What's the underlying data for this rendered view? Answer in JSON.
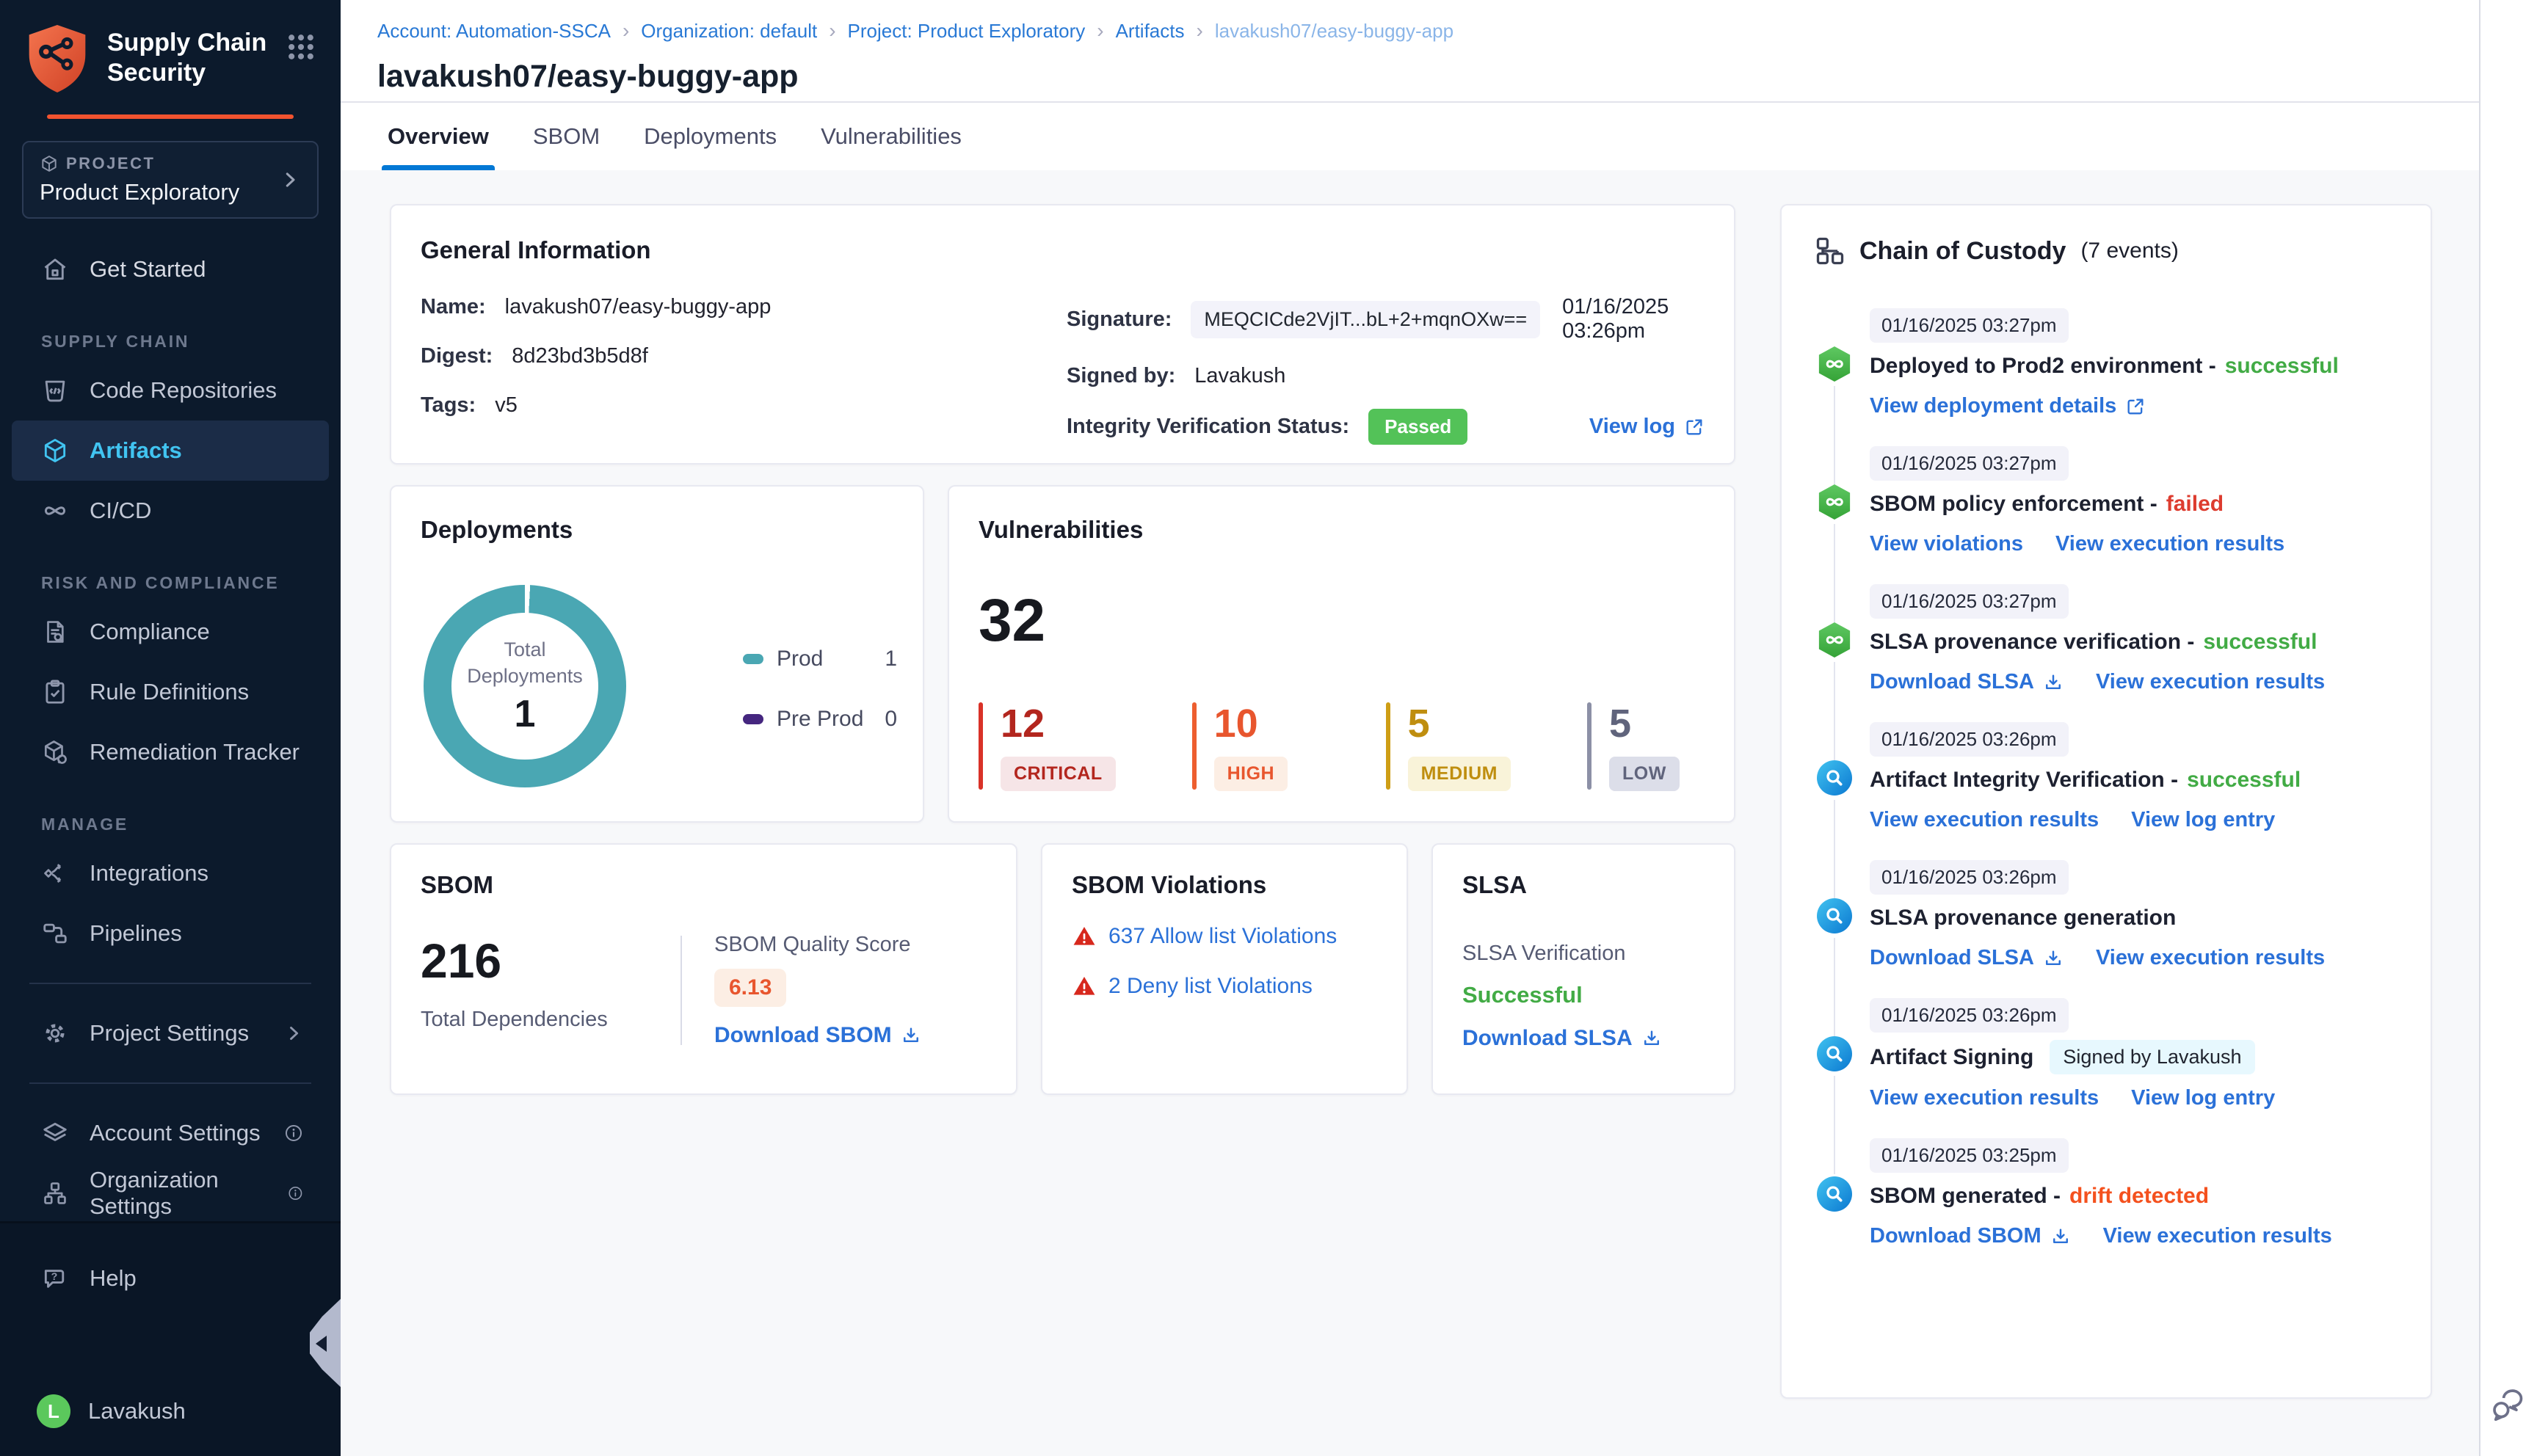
{
  "app": {
    "name_line1": "Supply Chain",
    "name_line2": "Security"
  },
  "sidebar": {
    "project_label": "PROJECT",
    "project_name": "Product Exploratory",
    "get_started": "Get Started",
    "sections": [
      {
        "title": "SUPPLY CHAIN",
        "items": [
          {
            "label": "Code Repositories"
          },
          {
            "label": "Artifacts",
            "active": true
          },
          {
            "label": "CI/CD"
          }
        ]
      },
      {
        "title": "RISK AND COMPLIANCE",
        "items": [
          {
            "label": "Compliance"
          },
          {
            "label": "Rule Definitions"
          },
          {
            "label": "Remediation Tracker"
          }
        ]
      },
      {
        "title": "MANAGE",
        "items": [
          {
            "label": "Integrations"
          },
          {
            "label": "Pipelines"
          }
        ]
      }
    ],
    "project_settings": "Project Settings",
    "account_settings": "Account Settings",
    "organization_settings": "Organization Settings",
    "help": "Help",
    "user": {
      "name": "Lavakush",
      "initial": "L"
    }
  },
  "breadcrumb": [
    "Account: Automation-SSCA",
    "Organization: default",
    "Project: Product Exploratory",
    "Artifacts",
    "lavakush07/easy-buggy-app"
  ],
  "page": {
    "title": "lavakush07/easy-buggy-app"
  },
  "tabs": [
    {
      "label": "Overview",
      "active": true
    },
    {
      "label": "SBOM"
    },
    {
      "label": "Deployments"
    },
    {
      "label": "Vulnerabilities"
    }
  ],
  "general_info": {
    "title": "General Information",
    "name_label": "Name:",
    "name_value": "lavakush07/easy-buggy-app",
    "digest_label": "Digest:",
    "digest_value": "8d23bd3b5d8f",
    "tags_label": "Tags:",
    "tags_value": "v5",
    "signature_label": "Signature:",
    "signature_value": "MEQCICde2VjIT...bL+2+mqnOXw==",
    "signature_time": "01/16/2025 03:26pm",
    "signed_by_label": "Signed by:",
    "signed_by_value": "Lavakush",
    "integrity_label": "Integrity Verification Status:",
    "integrity_status": "Passed",
    "view_log": "View log"
  },
  "deployments_card": {
    "title": "Deployments",
    "chart_data": {
      "type": "pie",
      "center_label": "Total Deployments",
      "total": 1,
      "series": [
        {
          "name": "Prod",
          "value": 1,
          "color": "#4AA7B3"
        },
        {
          "name": "Pre Prod",
          "value": 0,
          "color": "#45267F"
        }
      ]
    },
    "total_label": "Total Deployments",
    "total_value": "1",
    "legend": [
      {
        "label": "Prod",
        "value": "1"
      },
      {
        "label": "Pre Prod",
        "value": "0"
      }
    ]
  },
  "vulnerabilities_card": {
    "title": "Vulnerabilities",
    "total": "32",
    "severities": [
      {
        "count": "12",
        "label": "CRITICAL"
      },
      {
        "count": "10",
        "label": "HIGH"
      },
      {
        "count": "5",
        "label": "MEDIUM"
      },
      {
        "count": "5",
        "label": "LOW"
      }
    ]
  },
  "sbom_card": {
    "title": "SBOM",
    "total": "216",
    "total_label": "Total Dependencies",
    "quality_label": "SBOM Quality Score",
    "quality_score": "6.13",
    "download": "Download SBOM"
  },
  "sbom_violations_card": {
    "title": "SBOM Violations",
    "allow": "637 Allow list Violations",
    "deny": "2 Deny list Violations"
  },
  "slsa_card": {
    "title": "SLSA",
    "verification_label": "SLSA Verification",
    "verification_status": "Successful",
    "download": "Download SLSA"
  },
  "chain": {
    "title": "Chain of Custody",
    "count": "(7 events)",
    "events": [
      {
        "time": "01/16/2025 03:27pm",
        "module": "cd",
        "title": "Deployed to Prod2 environment -",
        "status": "successful",
        "links": [
          {
            "label": "View deployment details"
          }
        ]
      },
      {
        "time": "01/16/2025 03:27pm",
        "module": "cd",
        "title": "SBOM policy enforcement -",
        "status": "failed",
        "links": [
          {
            "label": "View violations"
          },
          {
            "label": "View execution results"
          }
        ]
      },
      {
        "time": "01/16/2025 03:27pm",
        "module": "cd",
        "title": "SLSA provenance verification -",
        "status": "successful",
        "links": [
          {
            "label": "Download SLSA"
          },
          {
            "label": "View execution results"
          }
        ]
      },
      {
        "time": "01/16/2025 03:26pm",
        "module": "scan",
        "title": "Artifact Integrity Verification -",
        "status": "successful",
        "links": [
          {
            "label": "View execution results"
          },
          {
            "label": "View log entry"
          }
        ]
      },
      {
        "time": "01/16/2025 03:26pm",
        "module": "scan",
        "title": "SLSA provenance generation",
        "status": "",
        "links": [
          {
            "label": "Download SLSA"
          },
          {
            "label": "View execution results"
          }
        ]
      },
      {
        "time": "01/16/2025 03:26pm",
        "module": "scan",
        "title": "Artifact Signing",
        "badge": "Signed by Lavakush",
        "links": [
          {
            "label": "View execution results"
          },
          {
            "label": "View log entry"
          }
        ]
      },
      {
        "time": "01/16/2025 03:25pm",
        "module": "scan",
        "title": "SBOM generated -",
        "status": "drift detected",
        "links": [
          {
            "label": "Download SBOM"
          },
          {
            "label": "View execution results"
          }
        ]
      }
    ]
  },
  "colors": {
    "accent_blue": "#0278D5",
    "link_blue": "#2B71D8",
    "sidebar_bg": "#0C1A2C",
    "brand_orange": "#F2532F",
    "passed_green": "#53C258",
    "success_green": "#42AB45",
    "failed_red": "#DD3C2F",
    "drift_orange": "#F4511E",
    "donut_teal": "#4AA7B3",
    "preprod_purple": "#45267F",
    "critical": "#B3261E",
    "high": "#E8562E",
    "medium": "#BF8E0F",
    "low": "#60647C"
  }
}
